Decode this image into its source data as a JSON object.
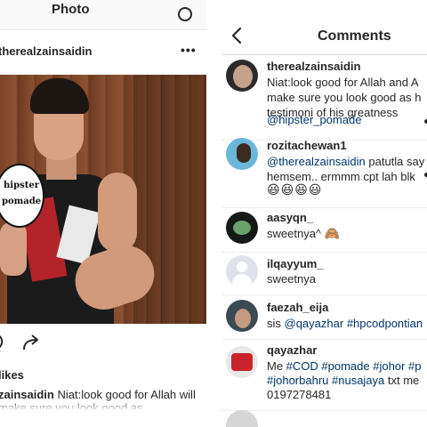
{
  "left": {
    "header_title": "Photo",
    "username": "therealzainsaidin",
    "more": "•••",
    "product_text": "hipster pomade",
    "likes": "likes",
    "caption_user": "zainsaidin",
    "caption_text": " Niat:look good for Allah will make sure you look good as"
  },
  "right": {
    "header_title": "Comments",
    "comments": [
      {
        "user": "therealzainsaidin",
        "lines": [
          "Niat:look good for Allah and A",
          "make sure you look good as h",
          "testimoni of his greatness"
        ],
        "tag": "@hipster_pomade"
      },
      {
        "user": "rozitachewan1",
        "mention": "@therealzainsaidin",
        "line1_rest": " patutla say",
        "line2": "hemsem.. ermmm cpt lah blk",
        "emojis": "😆😆😆😃"
      },
      {
        "user": "aasyqn_",
        "text": "sweetnya^ ",
        "emoji": "🙈"
      },
      {
        "user": "ilqayyum_",
        "text": "sweetnya"
      },
      {
        "user": "faezah_eija",
        "prefix": "sis ",
        "tag1": "@qayazhar",
        "tag2": "#hpcodpontian"
      },
      {
        "user": "qayazhar",
        "prefix": "Me ",
        "tags_line1": "#COD #pomade #johor #p",
        "tags_line2": "#johorbahru #nusajaya",
        "suffix2": " txt me",
        "line3": "0197278481"
      }
    ]
  },
  "colors": {
    "hashtag": "#003569",
    "text": "#262626",
    "divider": "#dbdbdb"
  },
  "icons": [
    "back-chevron-icon",
    "more-dots-icon",
    "comment-icon",
    "share-icon",
    "header-circle-icon"
  ]
}
